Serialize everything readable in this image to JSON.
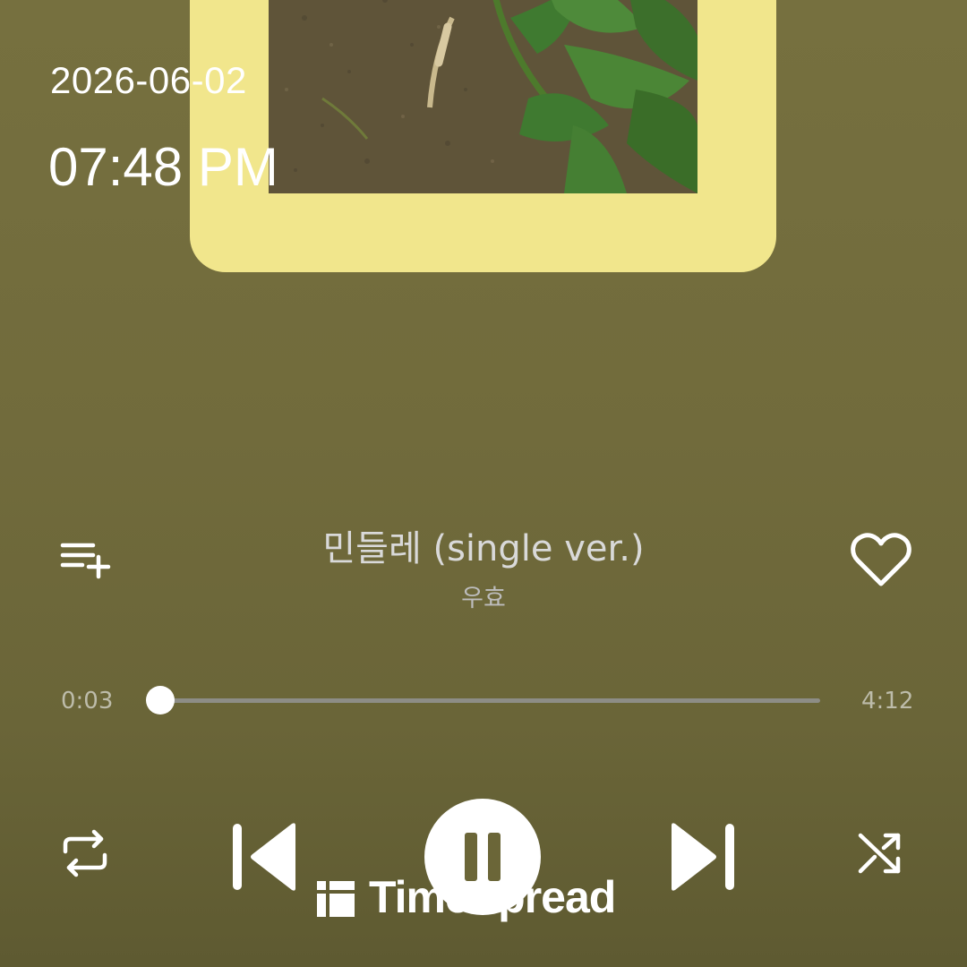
{
  "status": {
    "date": "2026-06-02",
    "time": "07:48 PM"
  },
  "album_art": {
    "frame_color": "#f1e68c",
    "description_icon": "album-cover-image"
  },
  "track": {
    "title": "민들레 (single ver.)",
    "artist": "우효",
    "liked": false
  },
  "playback": {
    "current_time": "0:03",
    "total_time": "4:12",
    "progress_fraction": 0.012,
    "state": "playing"
  },
  "controls": {
    "playlist_add_icon": "playlist-add-icon",
    "like_icon": "heart-outline-icon",
    "repeat_icon": "repeat-icon",
    "previous_icon": "skip-previous-icon",
    "play_pause_icon": "pause-icon",
    "next_icon": "skip-next-icon",
    "shuffle_icon": "shuffle-icon"
  },
  "watermark": {
    "text": "TimeSpread"
  },
  "colors": {
    "background": "#716b3c",
    "accent": "#ffffff",
    "frame": "#f1e68c"
  }
}
